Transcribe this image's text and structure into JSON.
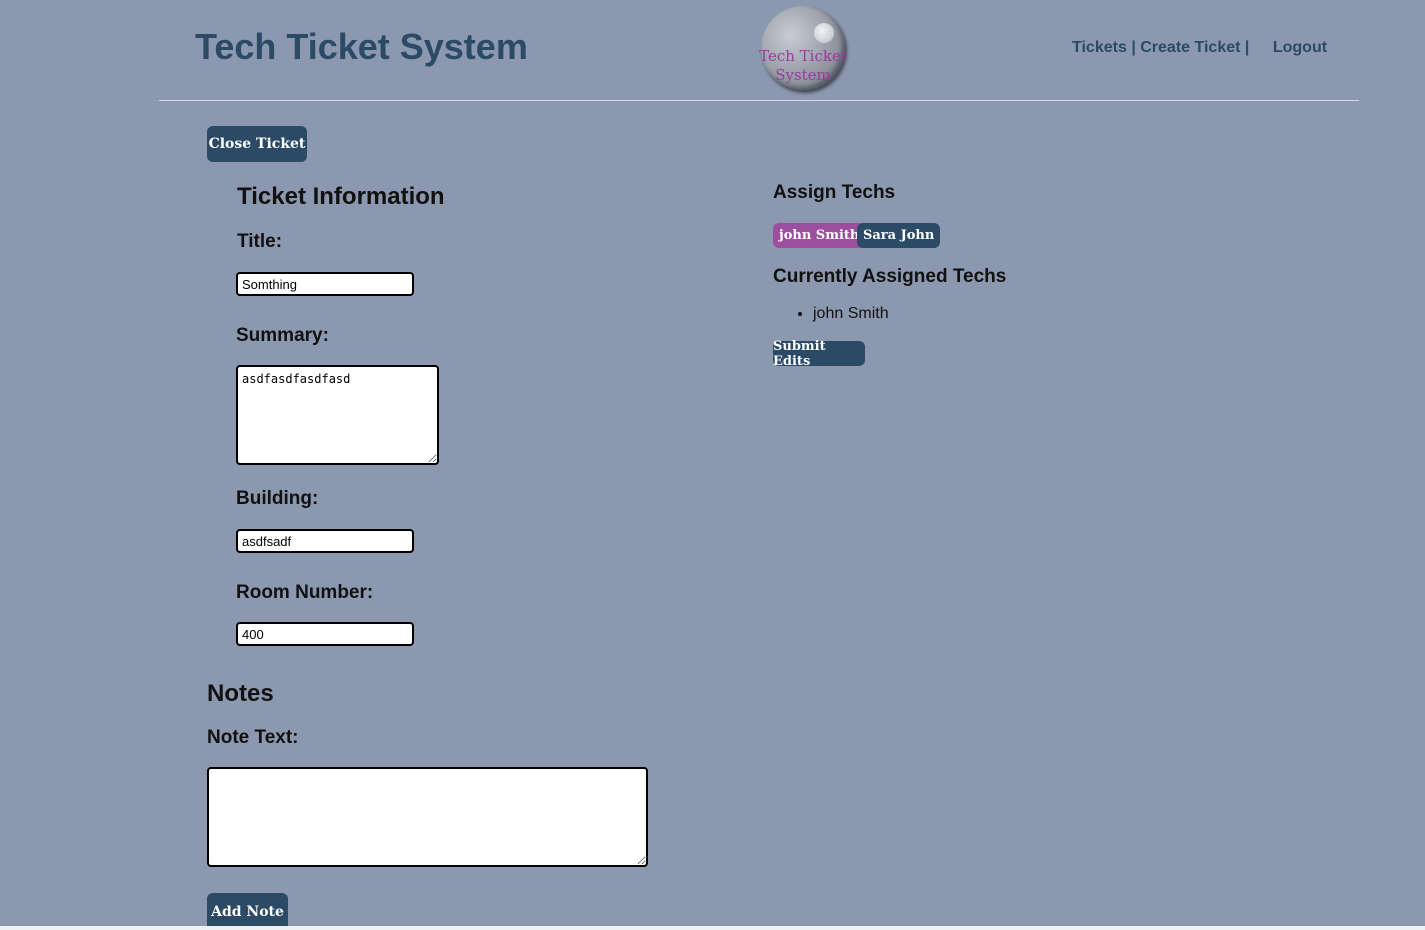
{
  "header": {
    "title": "Tech Ticket System",
    "logo_text_line1": "Tech Ticket",
    "logo_text_line2": "System",
    "nav": {
      "tickets": "Tickets",
      "separator": "|",
      "create_ticket": "Create Ticket",
      "logout": "Logout"
    }
  },
  "actions": {
    "close_ticket": "Close Ticket"
  },
  "ticket_info": {
    "heading": "Ticket Information",
    "title_label": "Title:",
    "title_value": "Somthing",
    "summary_label": "Summary:",
    "summary_value": "asdfasdfasdfasd",
    "building_label": "Building:",
    "building_value": "asdfsadf",
    "room_label": "Room Number:",
    "room_value": "400"
  },
  "notes": {
    "heading": "Notes",
    "note_text_label": "Note Text:",
    "note_text_value": "",
    "add_note": "Add Note"
  },
  "techs": {
    "assign_heading": "Assign Techs",
    "available": [
      {
        "name": "john Smith",
        "color": "#9c4f9e",
        "selected": true
      },
      {
        "name": "Sara John",
        "color": "#2a4a66",
        "selected": false
      }
    ],
    "assigned_heading": "Currently Assigned Techs",
    "assigned": [
      "john Smith"
    ],
    "submit_edits": "Submit Edits"
  },
  "colors": {
    "background": "#8c98b0",
    "primary": "#2a4a66",
    "accent": "#9c4f9e"
  }
}
